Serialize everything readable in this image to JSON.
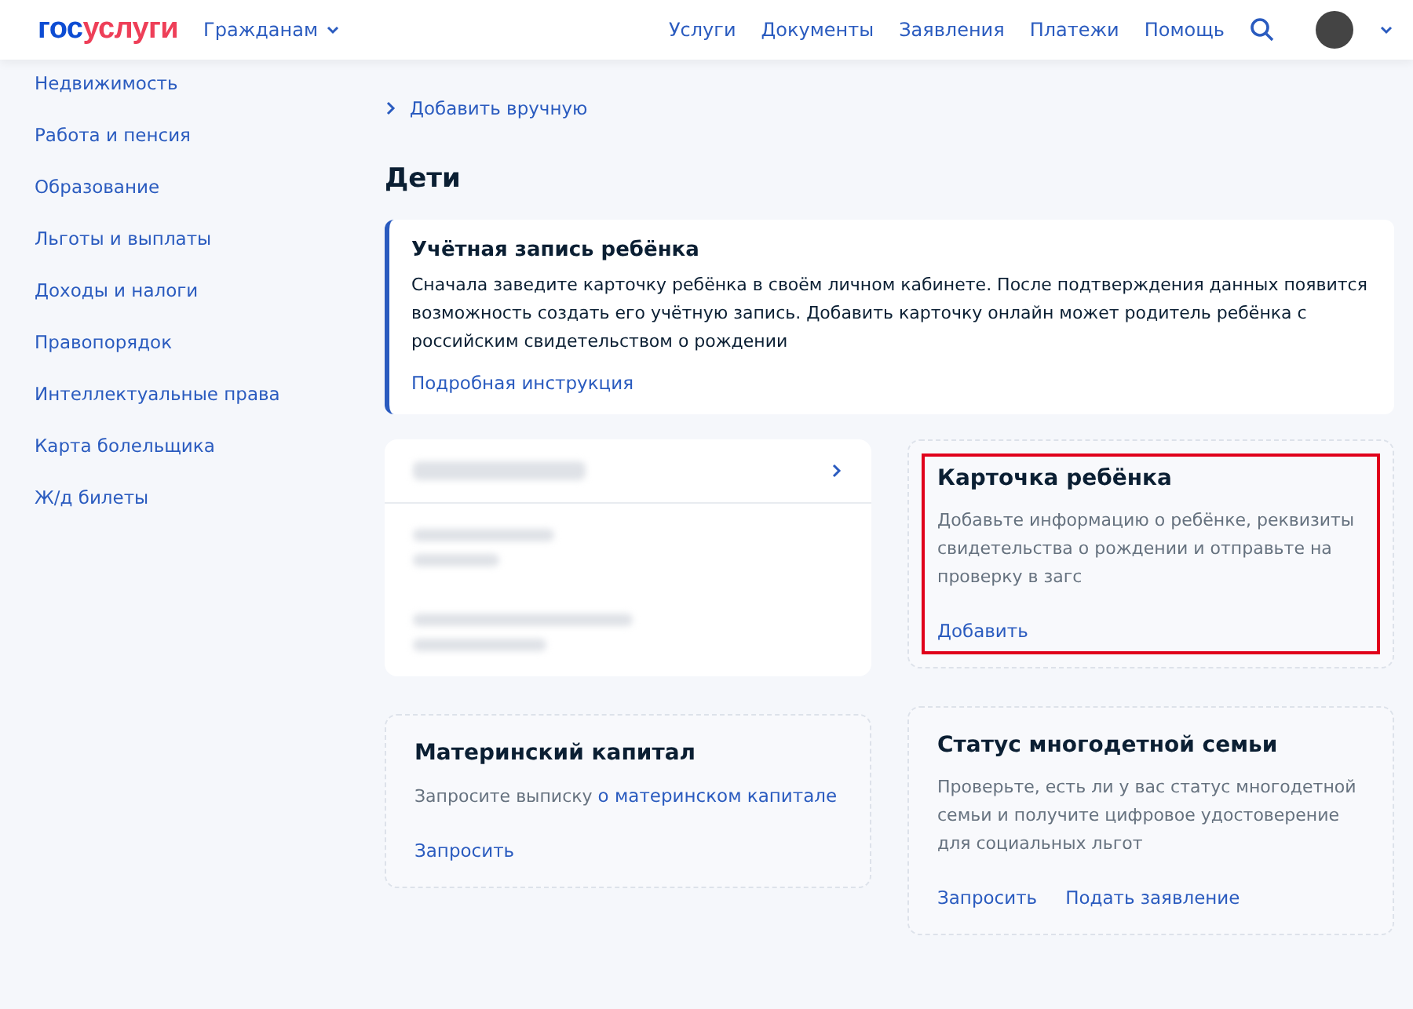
{
  "header": {
    "logo": {
      "prefix": "гос",
      "suffix": "услуги"
    },
    "audience": "Гражданам",
    "nav": [
      "Услуги",
      "Документы",
      "Заявления",
      "Платежи",
      "Помощь"
    ]
  },
  "sidebar": {
    "items": [
      "Недвижимость",
      "Работа и пенсия",
      "Образование",
      "Льготы и выплаты",
      "Доходы и налоги",
      "Правопорядок",
      "Интеллектуальные права",
      "Карта болельщика",
      "Ж/д билеты"
    ]
  },
  "main": {
    "add_link": "Добавить вручную",
    "section_title": "Дети",
    "info_card": {
      "title": "Учётная запись ребёнка",
      "text": "Сначала заведите карточку ребёнка в своём личном кабинете. После подтверждения данных появится возможность создать его учётную запись. Добавить карточку онлайн может родитель ребёнка с российским свидетельством о рождении",
      "link": "Подробная инструкция"
    },
    "cards": [
      {
        "kind": "child",
        "blurred": true
      },
      {
        "kind": "action",
        "title": "Карточка ребёнка",
        "text": "Добавьте информацию о ребёнке, реквизиты свидетельства о рождении и отправьте на проверку в загс",
        "actions": [
          "Добавить"
        ],
        "highlighted": true
      },
      {
        "kind": "action",
        "title": "Материнский капитал",
        "text": "Запросите выписку",
        "text_link": "о материнском капитале",
        "actions": [
          "Запросить"
        ],
        "highlighted": false
      },
      {
        "kind": "action",
        "title": "Статус многодетной семьи",
        "text": "Проверьте, есть ли у вас статус многодетной семьи и получите цифровое удостоверение для социальных льгот",
        "actions": [
          "Запросить",
          "Подать заявление"
        ],
        "highlighted": false
      }
    ]
  }
}
